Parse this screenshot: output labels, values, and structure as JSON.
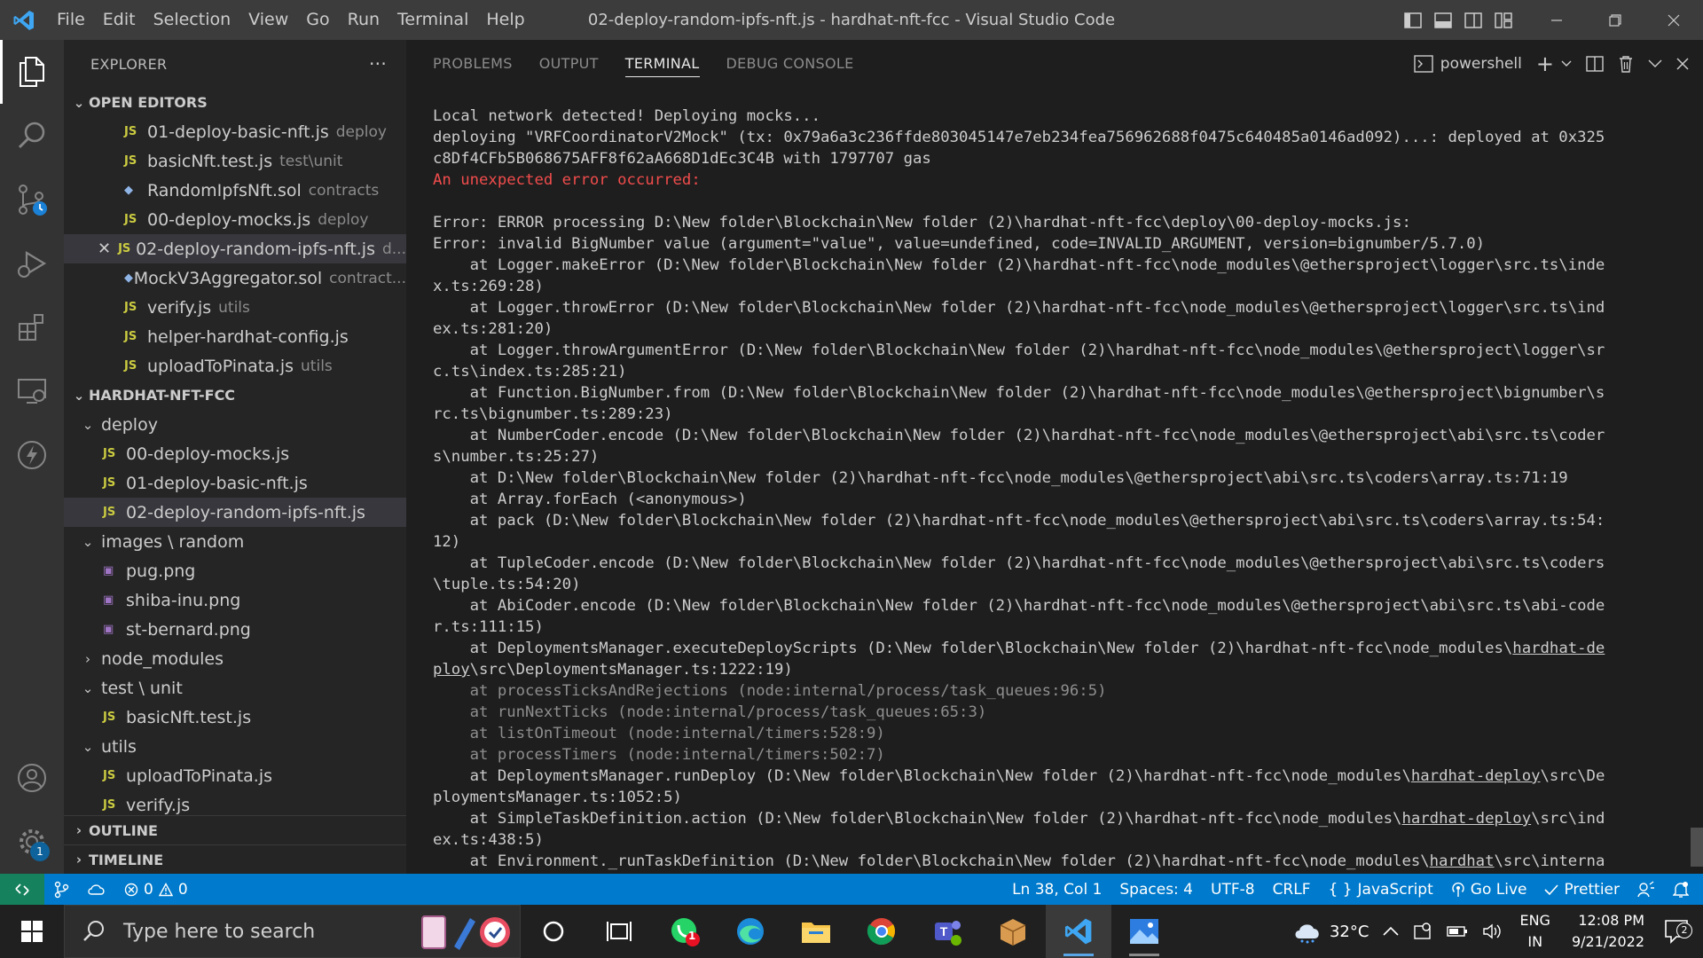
{
  "window": {
    "title": "02-deploy-random-ipfs-nft.js - hardhat-nft-fcc - Visual Studio Code",
    "menu": [
      "File",
      "Edit",
      "Selection",
      "View",
      "Go",
      "Run",
      "Terminal",
      "Help"
    ]
  },
  "sidebar": {
    "title": "EXPLORER",
    "more": "···",
    "open_editors_label": "OPEN EDITORS",
    "open_editors": [
      {
        "icon": "JS",
        "name": "01-deploy-basic-nft.js",
        "desc": "deploy"
      },
      {
        "icon": "JS",
        "name": "basicNft.test.js",
        "desc": "test\\unit"
      },
      {
        "icon": "sol",
        "name": "RandomIpfsNft.sol",
        "desc": "contracts"
      },
      {
        "icon": "JS",
        "name": "00-deploy-mocks.js",
        "desc": "deploy"
      },
      {
        "icon": "JS",
        "name": "02-deploy-random-ipfs-nft.js",
        "desc": "d..."
      },
      {
        "icon": "sol",
        "name": "MockV3Aggregator.sol",
        "desc": "contract..."
      },
      {
        "icon": "JS",
        "name": "verify.js",
        "desc": "utils"
      },
      {
        "icon": "JS",
        "name": "helper-hardhat-config.js",
        "desc": ""
      },
      {
        "icon": "JS",
        "name": "uploadToPinata.js",
        "desc": "utils"
      }
    ],
    "project_label": "HARDHAT-NFT-FCC",
    "tree": [
      {
        "type": "folder",
        "name": "deploy",
        "open": true,
        "depth": 1
      },
      {
        "type": "js",
        "name": "00-deploy-mocks.js",
        "depth": 2
      },
      {
        "type": "js",
        "name": "01-deploy-basic-nft.js",
        "depth": 2
      },
      {
        "type": "js",
        "name": "02-deploy-random-ipfs-nft.js",
        "depth": 2
      },
      {
        "type": "folder",
        "name": "images \\ random",
        "open": true,
        "depth": 1
      },
      {
        "type": "png",
        "name": "pug.png",
        "depth": 2
      },
      {
        "type": "png",
        "name": "shiba-inu.png",
        "depth": 2
      },
      {
        "type": "png",
        "name": "st-bernard.png",
        "depth": 2
      },
      {
        "type": "folder",
        "name": "node_modules",
        "open": false,
        "depth": 1
      },
      {
        "type": "folder",
        "name": "test \\ unit",
        "open": true,
        "depth": 1
      },
      {
        "type": "js",
        "name": "basicNft.test.js",
        "depth": 2
      },
      {
        "type": "folder",
        "name": "utils",
        "open": true,
        "depth": 1
      },
      {
        "type": "js",
        "name": "uploadToPinata.js",
        "depth": 2
      },
      {
        "type": "js",
        "name": "verify.js",
        "depth": 2
      }
    ],
    "outline_label": "OUTLINE",
    "timeline_label": "TIMELINE"
  },
  "panel": {
    "tabs": [
      "PROBLEMS",
      "OUTPUT",
      "TERMINAL",
      "DEBUG CONSOLE"
    ],
    "active_tab": "TERMINAL",
    "shell": "powershell",
    "lines": [
      {
        "t": "Local network detected! Deploying mocks...",
        "c": ""
      },
      {
        "t": "deploying \"VRFCoordinatorV2Mock\" (tx: 0x79a6a3c236ffde803045147e7eb234fea756962688f0475c640485a0146ad092)...: deployed at 0x325",
        "c": ""
      },
      {
        "t": "c8Df4CFb5B068675AFF8f62aA668D1dEc3C4B with 1797707 gas",
        "c": ""
      },
      {
        "t": "An unexpected error occurred:",
        "c": "err"
      },
      {
        "t": "",
        "c": ""
      },
      {
        "t": "Error: ERROR processing D:\\New folder\\Blockchain\\New folder (2)\\hardhat-nft-fcc\\deploy\\00-deploy-mocks.js:",
        "c": ""
      },
      {
        "t": "Error: invalid BigNumber value (argument=\"value\", value=undefined, code=INVALID_ARGUMENT, version=bignumber/5.7.0)",
        "c": ""
      },
      {
        "t": "    at Logger.makeError (D:\\New folder\\Blockchain\\New folder (2)\\hardhat-nft-fcc\\node_modules\\@ethersproject\\logger\\src.ts\\inde",
        "c": ""
      },
      {
        "t": "x.ts:269:28)",
        "c": ""
      },
      {
        "t": "    at Logger.throwError (D:\\New folder\\Blockchain\\New folder (2)\\hardhat-nft-fcc\\node_modules\\@ethersproject\\logger\\src.ts\\ind",
        "c": ""
      },
      {
        "t": "ex.ts:281:20)",
        "c": ""
      },
      {
        "t": "    at Logger.throwArgumentError (D:\\New folder\\Blockchain\\New folder (2)\\hardhat-nft-fcc\\node_modules\\@ethersproject\\logger\\sr",
        "c": ""
      },
      {
        "t": "c.ts\\index.ts:285:21)",
        "c": ""
      },
      {
        "t": "    at Function.BigNumber.from (D:\\New folder\\Blockchain\\New folder (2)\\hardhat-nft-fcc\\node_modules\\@ethersproject\\bignumber\\s",
        "c": ""
      },
      {
        "t": "rc.ts\\bignumber.ts:289:23)",
        "c": ""
      },
      {
        "t": "    at NumberCoder.encode (D:\\New folder\\Blockchain\\New folder (2)\\hardhat-nft-fcc\\node_modules\\@ethersproject\\abi\\src.ts\\coder",
        "c": ""
      },
      {
        "t": "s\\number.ts:25:27)",
        "c": ""
      },
      {
        "t": "    at D:\\New folder\\Blockchain\\New folder (2)\\hardhat-nft-fcc\\node_modules\\@ethersproject\\abi\\src.ts\\coders\\array.ts:71:19",
        "c": ""
      },
      {
        "t": "    at Array.forEach (<anonymous>)",
        "c": ""
      },
      {
        "t": "    at pack (D:\\New folder\\Blockchain\\New folder (2)\\hardhat-nft-fcc\\node_modules\\@ethersproject\\abi\\src.ts\\coders\\array.ts:54:",
        "c": ""
      },
      {
        "t": "12)",
        "c": ""
      },
      {
        "t": "    at TupleCoder.encode (D:\\New folder\\Blockchain\\New folder (2)\\hardhat-nft-fcc\\node_modules\\@ethersproject\\abi\\src.ts\\coders",
        "c": ""
      },
      {
        "t": "\\tuple.ts:54:20)",
        "c": ""
      },
      {
        "t": "    at AbiCoder.encode (D:\\New folder\\Blockchain\\New folder (2)\\hardhat-nft-fcc\\node_modules\\@ethersproject\\abi\\src.ts\\abi-code",
        "c": ""
      },
      {
        "t": "r.ts:111:15)",
        "c": ""
      },
      {
        "t": "    at DeploymentsManager.executeDeployScripts (D:\\New folder\\Blockchain\\New folder (2)\\hardhat-nft-fcc\\node_modules\\",
        "c": "",
        "u": "hardhat-de"
      },
      {
        "t": "\\src\\DeploymentsManager.ts:1222:19)",
        "c": "",
        "up": "ploy"
      },
      {
        "t": "    at processTicksAndRejections (node:internal/process/task_queues:96:5)",
        "c": "dim"
      },
      {
        "t": "    at runNextTicks (node:internal/process/task_queues:65:3)",
        "c": "dim"
      },
      {
        "t": "    at listOnTimeout (node:internal/timers:528:9)",
        "c": "dim"
      },
      {
        "t": "    at processTimers (node:internal/timers:502:7)",
        "c": "dim"
      },
      {
        "t": "    at DeploymentsManager.runDeploy (D:\\New folder\\Blockchain\\New folder (2)\\hardhat-nft-fcc\\node_modules\\",
        "c": "",
        "u": "hardhat-deploy",
        "after": "\\src\\De"
      },
      {
        "t": "ploymentsManager.ts:1052:5)",
        "c": ""
      },
      {
        "t": "    at SimpleTaskDefinition.action (D:\\New folder\\Blockchain\\New folder (2)\\hardhat-nft-fcc\\node_modules\\",
        "c": "",
        "u": "hardhat-deploy",
        "after": "\\src\\ind"
      },
      {
        "t": "ex.ts:438:5)",
        "c": ""
      },
      {
        "t": "    at Environment._runTaskDefinition (D:\\New folder\\Blockchain\\New folder (2)\\hardhat-nft-fcc\\node_modules\\",
        "c": "",
        "u": "hardhat",
        "after": "\\src\\interna"
      }
    ]
  },
  "statusbar": {
    "errors": "0",
    "warnings": "0",
    "position": "Ln 38, Col 1",
    "spaces": "Spaces: 4",
    "encoding": "UTF-8",
    "eol": "CRLF",
    "language": "JavaScript",
    "golive": "Go Live",
    "prettier": "Prettier",
    "language_prefix": "{ }"
  },
  "activity": {
    "settings_badge": "1"
  },
  "taskbar": {
    "search_placeholder": "Type here to search",
    "whatsapp_badge": "1",
    "temperature": "32°C",
    "lang_top": "ENG",
    "lang_bottom": "IN",
    "time": "12:08 PM",
    "date": "9/21/2022",
    "notif_count": "2"
  },
  "colors": {
    "statusbar": "#007acc",
    "remote": "#16825d",
    "error": "#f14c4c",
    "accent": "#0e639c"
  }
}
